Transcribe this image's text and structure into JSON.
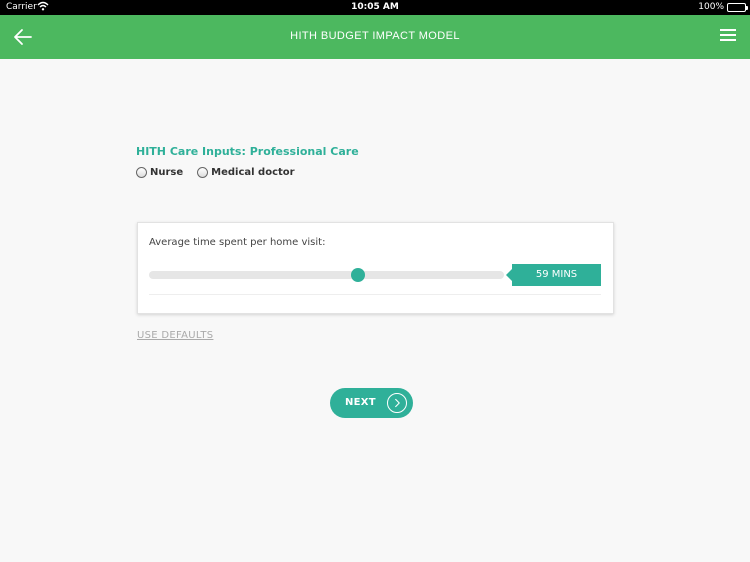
{
  "statusbar": {
    "carrier": "Carrier",
    "time": "10:05 AM",
    "battery": "100%"
  },
  "navbar": {
    "title": "HITH BUDGET IMPACT MODEL"
  },
  "section": {
    "title": "HITH Care Inputs: Professional Care"
  },
  "radios": [
    {
      "label": "Nurse",
      "selected": false
    },
    {
      "label": "Medical doctor",
      "selected": false
    }
  ],
  "slider": {
    "label": "Average time spent per home visit:",
    "value_text": "59 MINS",
    "level": 0.59
  },
  "actions": {
    "defaults": "USE DEFAULTS",
    "next": "NEXT"
  },
  "colors": {
    "nav": "#4cb85f",
    "accent": "#2fb099"
  }
}
